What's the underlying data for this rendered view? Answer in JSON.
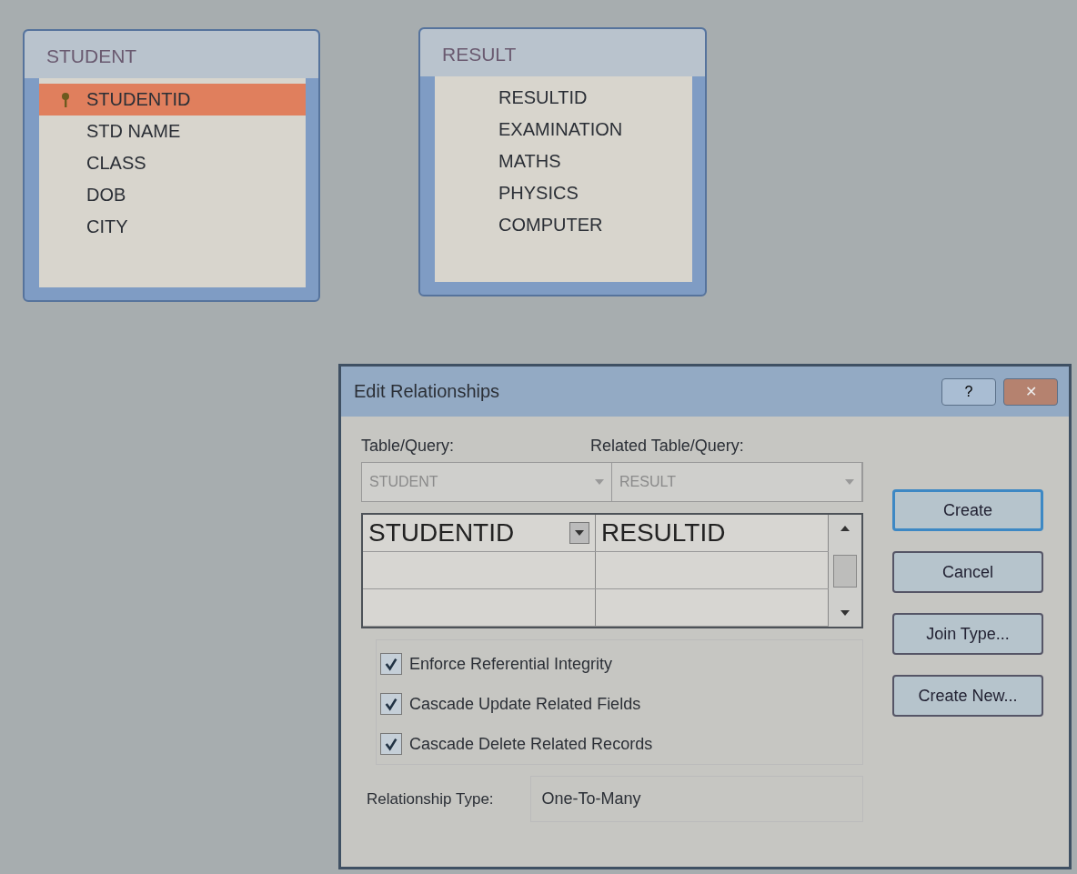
{
  "tables": [
    {
      "title": "STUDENT",
      "fields": [
        {
          "name": "STUDENTID",
          "key": true,
          "selected": true
        },
        {
          "name": "STD NAME",
          "key": false,
          "selected": false
        },
        {
          "name": "CLASS",
          "key": false,
          "selected": false
        },
        {
          "name": "DOB",
          "key": false,
          "selected": false
        },
        {
          "name": "CITY",
          "key": false,
          "selected": false
        }
      ]
    },
    {
      "title": "RESULT",
      "fields": [
        {
          "name": "RESULTID",
          "key": false,
          "selected": false
        },
        {
          "name": "EXAMINATION",
          "key": false,
          "selected": false
        },
        {
          "name": "MATHS",
          "key": false,
          "selected": false
        },
        {
          "name": "PHYSICS",
          "key": false,
          "selected": false
        },
        {
          "name": "COMPUTER",
          "key": false,
          "selected": false
        }
      ]
    }
  ],
  "dialog": {
    "title": "Edit Relationships",
    "help": "?",
    "close": "✕",
    "table_label": "Table/Query:",
    "related_label": "Related Table/Query:",
    "table_value": "STUDENT",
    "related_value": "RESULT",
    "rows": [
      {
        "field": "STUDENTID",
        "related_field": "RESULTID"
      }
    ],
    "checkboxes": [
      {
        "label": "Enforce Referential Integrity",
        "checked": true
      },
      {
        "label": "Cascade Update Related Fields",
        "checked": true
      },
      {
        "label": "Cascade Delete Related Records",
        "checked": true
      }
    ],
    "relationship_label": "Relationship Type:",
    "relationship_value": "One-To-Many",
    "buttons": [
      {
        "label": "Create",
        "default": true
      },
      {
        "label": "Cancel",
        "default": false
      },
      {
        "label": "Join Type...",
        "default": false
      },
      {
        "label": "Create New...",
        "default": false
      }
    ]
  }
}
